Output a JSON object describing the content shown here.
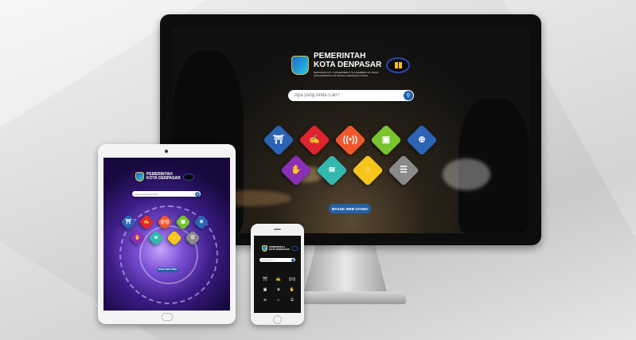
{
  "brand": {
    "title_line1": "PEMERINTAH",
    "title_line2": "KOTA DENPASAR",
    "subtitle_line1": "DENPASAR CITY GOVERNMENT IS A MEMBER OF OWHC",
    "subtitle_line2": "(ORGANIZATION OF WORLD HERITAGE CITIES)"
  },
  "search": {
    "placeholder": "Apa yang Anda Cari?"
  },
  "cta": {
    "label": "MASUK WEB UTAMA"
  },
  "tiles": [
    {
      "name": "monument-tile",
      "color": "#2b63b5",
      "icon": "monument-icon",
      "glyph": "⛩"
    },
    {
      "name": "announcement-tile",
      "color": "#e0242f",
      "icon": "signature-icon",
      "glyph": "✍"
    },
    {
      "name": "broadcast-tile",
      "color": "#f0572a",
      "icon": "broadcast-icon",
      "glyph": "((•))"
    },
    {
      "name": "cctv-tile",
      "color": "#7ac430",
      "icon": "cctv-icon",
      "glyph": "▣"
    },
    {
      "name": "globe-tile",
      "color": "#2b63b5",
      "icon": "globe-icon",
      "glyph": "⊕"
    },
    {
      "name": "handshake-tile",
      "color": "#8a2fb8",
      "icon": "handshake-icon",
      "glyph": "✋"
    },
    {
      "name": "layers-tile",
      "color": "#33b8b0",
      "icon": "layers-icon",
      "glyph": "≋"
    },
    {
      "name": "home-tile",
      "color": "#f5c519",
      "icon": "home-icon",
      "glyph": "⌂"
    },
    {
      "name": "document-tile",
      "color": "#8a8a8a",
      "icon": "document-icon",
      "glyph": "☰"
    }
  ]
}
